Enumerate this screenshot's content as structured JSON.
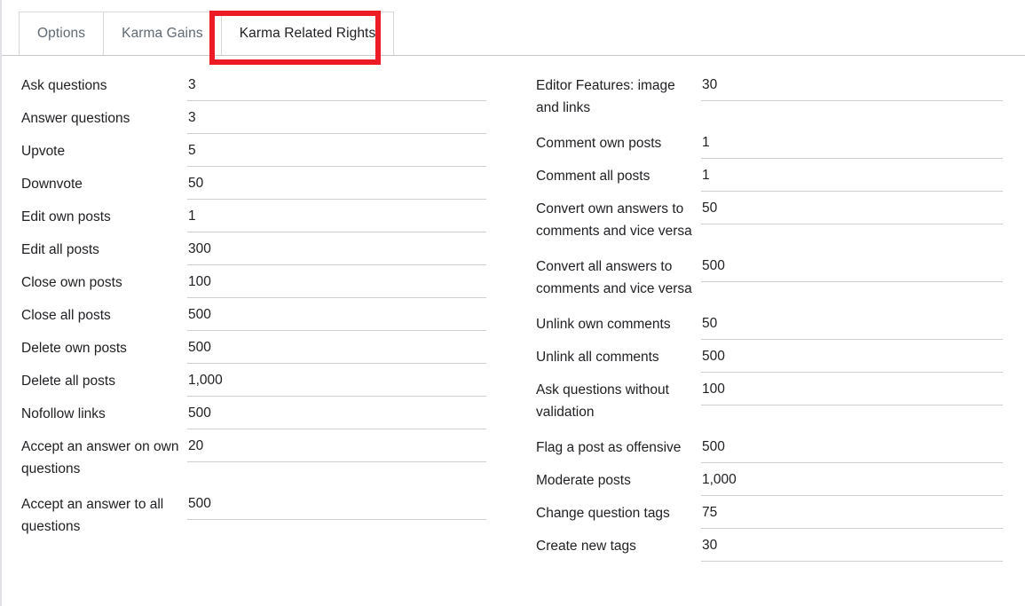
{
  "tabs": [
    {
      "label": "Options",
      "selected": false
    },
    {
      "label": "Karma Gains",
      "selected": false
    },
    {
      "label": "Karma Related Rights",
      "selected": true
    }
  ],
  "highlight": {
    "color": "#ed1c24",
    "target": "Karma Related Rights"
  },
  "left_column": [
    {
      "label": "Ask questions",
      "value": "3"
    },
    {
      "label": "Answer questions",
      "value": "3"
    },
    {
      "label": "Upvote",
      "value": "5"
    },
    {
      "label": "Downvote",
      "value": "50"
    },
    {
      "label": "Edit own posts",
      "value": "1"
    },
    {
      "label": "Edit all posts",
      "value": "300"
    },
    {
      "label": "Close own posts",
      "value": "100"
    },
    {
      "label": "Close all posts",
      "value": "500"
    },
    {
      "label": "Delete own posts",
      "value": "500"
    },
    {
      "label": "Delete all posts",
      "value": "1,000"
    },
    {
      "label": "Nofollow links",
      "value": "500"
    },
    {
      "label": "Accept an answer on own questions",
      "value": "20"
    },
    {
      "label": "Accept an answer to all questions",
      "value": "500"
    }
  ],
  "right_column": [
    {
      "label": "Editor Features: image and links",
      "value": "30"
    },
    {
      "label": "Comment own posts",
      "value": "1"
    },
    {
      "label": "Comment all posts",
      "value": "1"
    },
    {
      "label": "Convert own answers to comments and vice versa",
      "value": "50"
    },
    {
      "label": "Convert all answers to comments and vice versa",
      "value": "500"
    },
    {
      "label": "Unlink own comments",
      "value": "50"
    },
    {
      "label": "Unlink all comments",
      "value": "500"
    },
    {
      "label": "Ask questions without validation",
      "value": "100"
    },
    {
      "label": "Flag a post as offensive",
      "value": "500"
    },
    {
      "label": "Moderate posts",
      "value": "1,000"
    },
    {
      "label": "Change question tags",
      "value": "75"
    },
    {
      "label": "Create new tags",
      "value": "30"
    }
  ]
}
